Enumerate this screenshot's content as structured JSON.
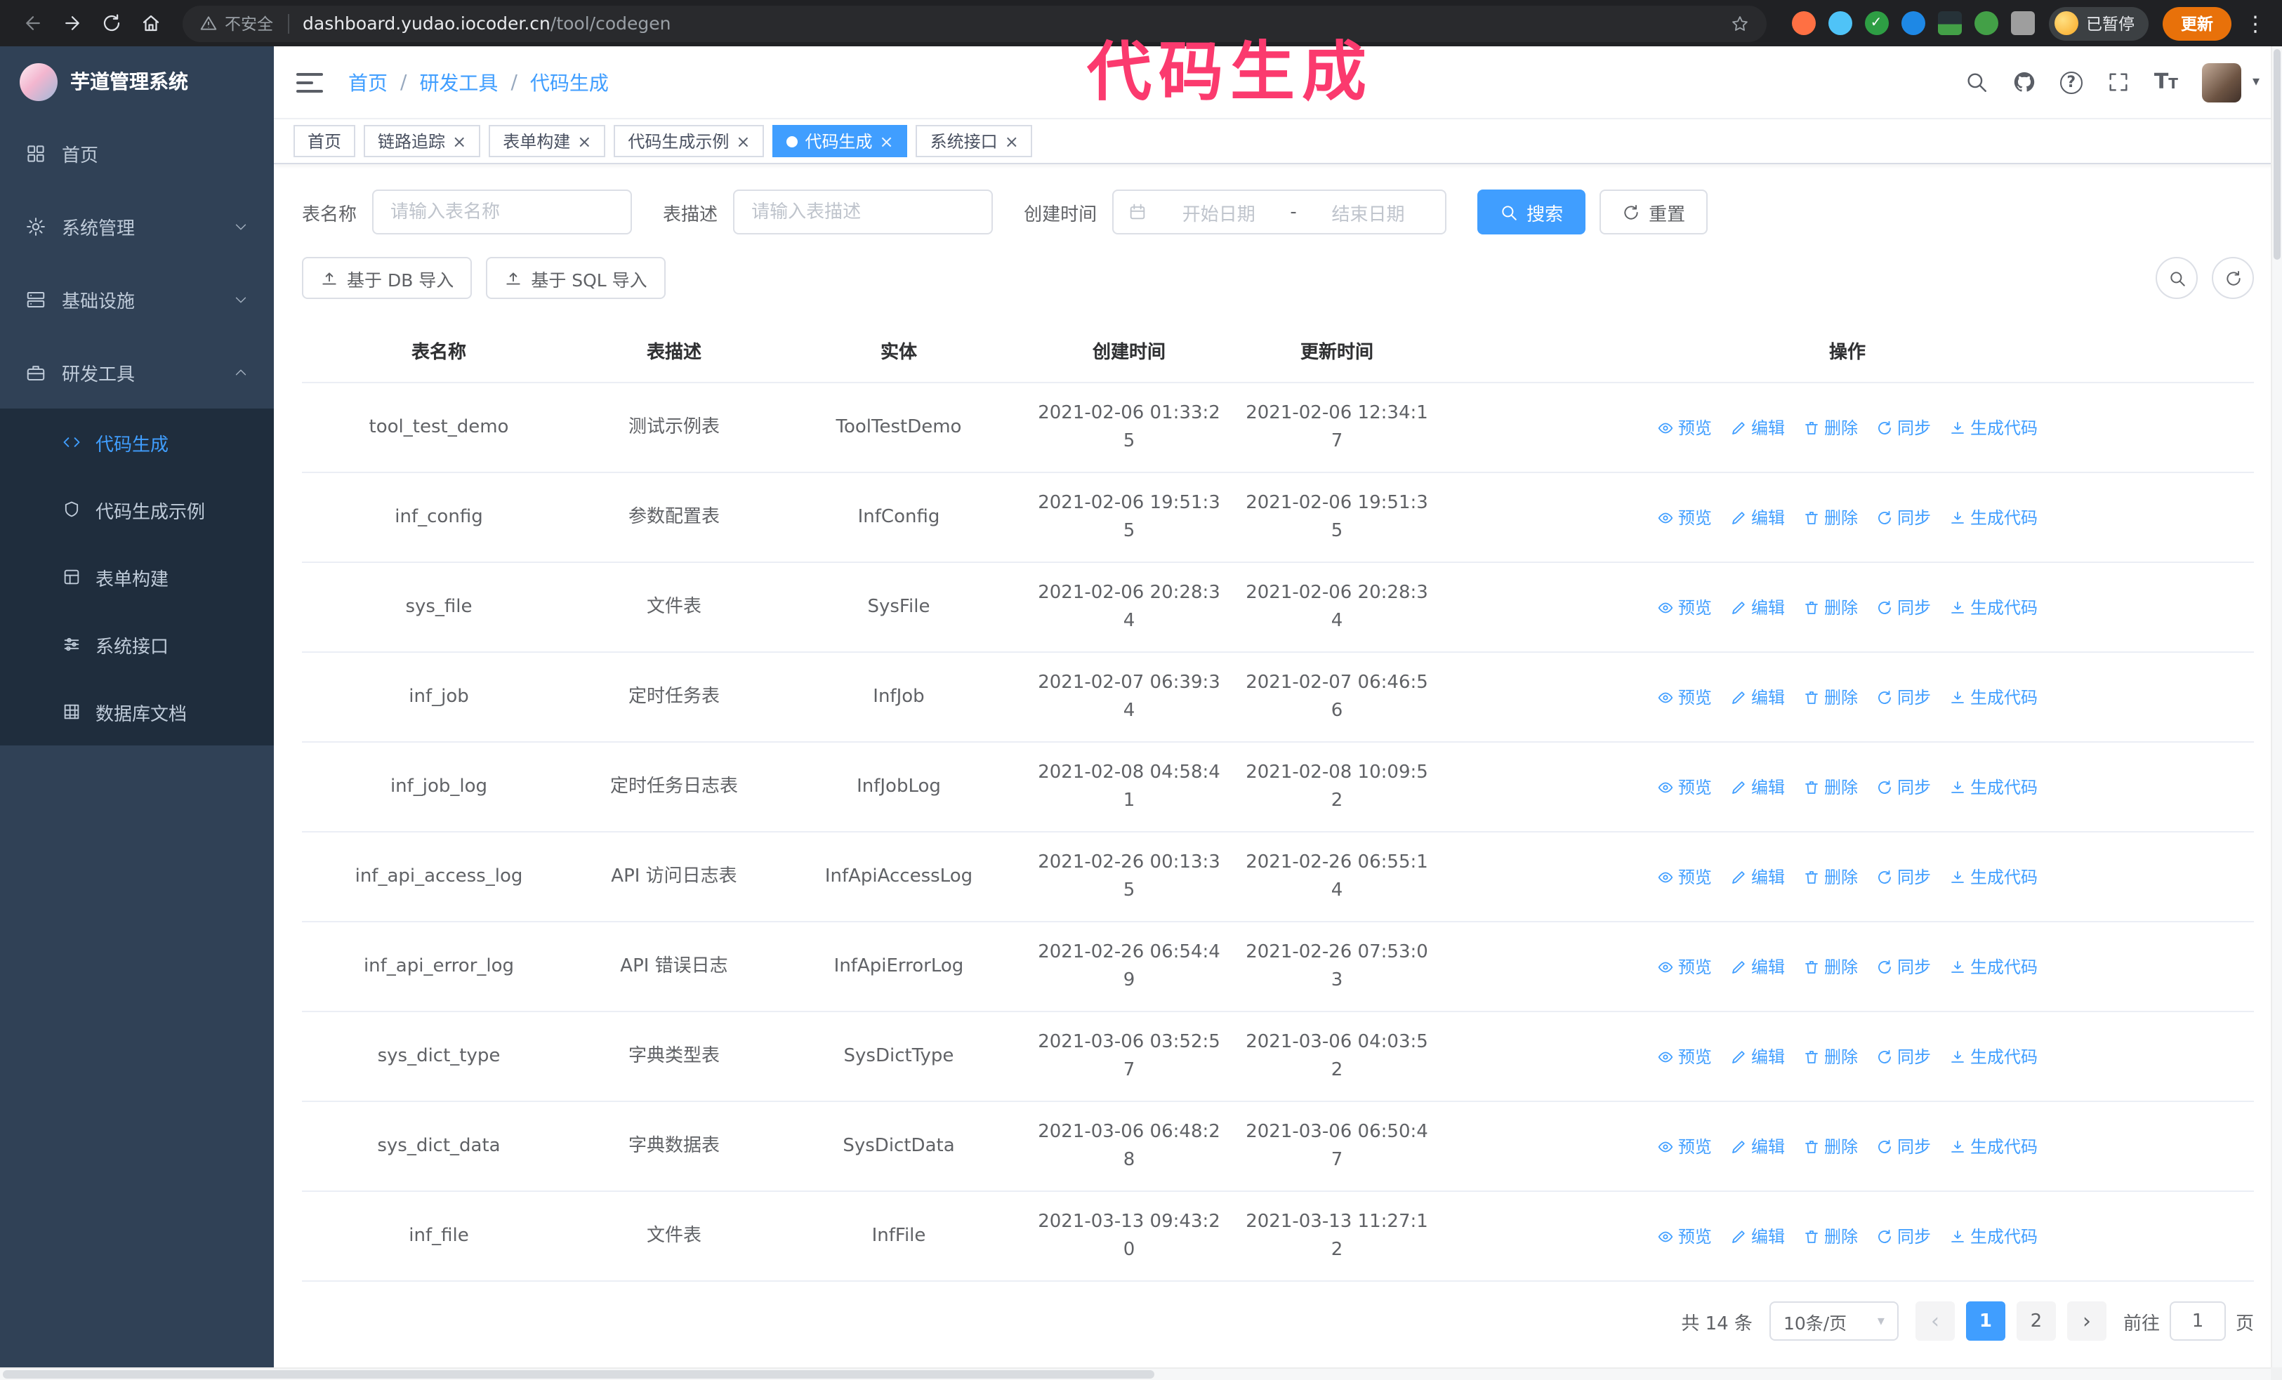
{
  "meta": {
    "accent_color": "#409eff",
    "sidebar_color": "#304156",
    "submenu_color": "#1f2d3d",
    "annotation_color": "#fb3a6e",
    "update_button_color": "#e8710a"
  },
  "annotation": {
    "text": "代码生成"
  },
  "browser": {
    "security_label": "不安全",
    "url_host": "dashboard.yudao.iocoder.cn",
    "url_path": "/tool/codegen",
    "profile_label": "已暂停",
    "update_label": "更新"
  },
  "sidebar": {
    "logo_title": "芋道管理系统",
    "items": [
      {
        "label": "首页"
      },
      {
        "label": "系统管理"
      },
      {
        "label": "基础设施"
      },
      {
        "label": "研发工具"
      }
    ],
    "submenu": [
      {
        "label": "代码生成"
      },
      {
        "label": "代码生成示例"
      },
      {
        "label": "表单构建"
      },
      {
        "label": "系统接口"
      },
      {
        "label": "数据库文档"
      }
    ]
  },
  "breadcrumb": {
    "items": [
      "首页",
      "研发工具",
      "代码生成"
    ]
  },
  "tabs": [
    {
      "label": "首页"
    },
    {
      "label": "链路追踪"
    },
    {
      "label": "表单构建"
    },
    {
      "label": "代码生成示例"
    },
    {
      "label": "代码生成"
    },
    {
      "label": "系统接口"
    }
  ],
  "filters": {
    "table_name_label": "表名称",
    "table_name_placeholder": "请输入表名称",
    "table_desc_label": "表描述",
    "table_desc_placeholder": "请输入表描述",
    "create_time_label": "创建时间",
    "date_start_placeholder": "开始日期",
    "date_separator": "-",
    "date_end_placeholder": "结束日期",
    "search_label": "搜索",
    "reset_label": "重置"
  },
  "toolbar": {
    "import_db_label": "基于 DB 导入",
    "import_sql_label": "基于 SQL 导入"
  },
  "table": {
    "columns": [
      "表名称",
      "表描述",
      "实体",
      "创建时间",
      "更新时间",
      "操作"
    ],
    "actions": [
      "预览",
      "编辑",
      "删除",
      "同步",
      "生成代码"
    ],
    "rows": [
      {
        "name": "tool_test_demo",
        "desc": "测试示例表",
        "entity": "ToolTestDemo",
        "create_time": "2021-02-06 01:33:25",
        "update_time": "2021-02-06 12:34:17"
      },
      {
        "name": "inf_config",
        "desc": "参数配置表",
        "entity": "InfConfig",
        "create_time": "2021-02-06 19:51:35",
        "update_time": "2021-02-06 19:51:35"
      },
      {
        "name": "sys_file",
        "desc": "文件表",
        "entity": "SysFile",
        "create_time": "2021-02-06 20:28:34",
        "update_time": "2021-02-06 20:28:34"
      },
      {
        "name": "inf_job",
        "desc": "定时任务表",
        "entity": "InfJob",
        "create_time": "2021-02-07 06:39:34",
        "update_time": "2021-02-07 06:46:56"
      },
      {
        "name": "inf_job_log",
        "desc": "定时任务日志表",
        "entity": "InfJobLog",
        "create_time": "2021-02-08 04:58:41",
        "update_time": "2021-02-08 10:09:52"
      },
      {
        "name": "inf_api_access_log",
        "desc": "API 访问日志表",
        "entity": "InfApiAccessLog",
        "create_time": "2021-02-26 00:13:35",
        "update_time": "2021-02-26 06:55:14"
      },
      {
        "name": "inf_api_error_log",
        "desc": "API 错误日志",
        "entity": "InfApiErrorLog",
        "create_time": "2021-02-26 06:54:49",
        "update_time": "2021-02-26 07:53:03"
      },
      {
        "name": "sys_dict_type",
        "desc": "字典类型表",
        "entity": "SysDictType",
        "create_time": "2021-03-06 03:52:57",
        "update_time": "2021-03-06 04:03:52"
      },
      {
        "name": "sys_dict_data",
        "desc": "字典数据表",
        "entity": "SysDictData",
        "create_time": "2021-03-06 06:48:28",
        "update_time": "2021-03-06 06:50:47"
      },
      {
        "name": "inf_file",
        "desc": "文件表",
        "entity": "InfFile",
        "create_time": "2021-03-13 09:43:20",
        "update_time": "2021-03-13 11:27:12"
      }
    ]
  },
  "pagination": {
    "total_label": "共 14 条",
    "page_size_label": "10条/页",
    "pages": [
      "1",
      "2"
    ],
    "active_page": "1",
    "goto_label": "前往",
    "goto_value": "1",
    "goto_suffix": "页"
  },
  "ui_glyphs": {
    "tab_close": "×",
    "breadcrumb_separator": "/",
    "pager_prev": "‹",
    "pager_next": "›",
    "dropdown_caret": "▾",
    "avatar_caret": "▾",
    "question_mark": "?",
    "kebab": "⋮",
    "check": "✓",
    "font_icon_large": "T",
    "font_icon_small": "T"
  }
}
